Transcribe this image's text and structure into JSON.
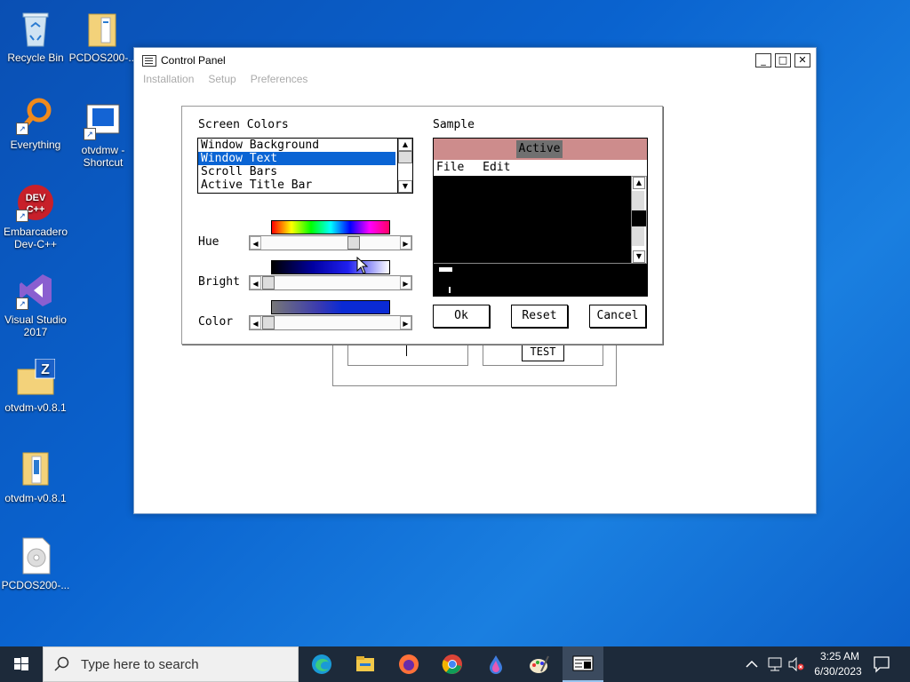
{
  "desktop": {
    "icons": [
      {
        "label": "Recycle Bin"
      },
      {
        "label": "PCDOS200-..."
      },
      {
        "label": "Everything"
      },
      {
        "label": "otvdmw -\nShortcut"
      },
      {
        "label": "Embarcadero\nDev-C++"
      },
      {
        "label": "Visual Studio\n2017"
      },
      {
        "label": "otvdm-v0.8.1"
      },
      {
        "label": "otvdm-v0.8.1"
      },
      {
        "label": "PCDOS200-..."
      }
    ]
  },
  "window": {
    "title": "Control Panel",
    "menu": [
      "Installation",
      "Setup",
      "Preferences"
    ],
    "controls": {
      "minimize": "_",
      "maximize": "□",
      "close": "✕"
    }
  },
  "background_dialog": {
    "test_label": "TEST"
  },
  "colors_dialog": {
    "screen_colors_label": "Screen Colors",
    "sample_label": "Sample",
    "list_items": [
      "Window Background",
      "Window Text",
      "Scroll Bars",
      "Active Title Bar"
    ],
    "selected_index": 1,
    "hue_label": "Hue",
    "bright_label": "Bright",
    "color_label": "Color",
    "hue_value": 0.7,
    "bright_value": 0.0,
    "color_value": 0.0,
    "sample": {
      "active_label": "Active",
      "menu_file": "File",
      "menu_edit": "Edit"
    },
    "buttons": {
      "ok": "Ok",
      "reset": "Reset",
      "cancel": "Cancel"
    },
    "colors": {
      "title_bar": "#cd8c8c",
      "active_box": "#707070",
      "selected": "#0a64d4",
      "color_swatch": "#0a2ad4"
    }
  },
  "taskbar": {
    "search_placeholder": "Type here to search",
    "time": "3:25 AM",
    "date": "6/30/2023"
  }
}
